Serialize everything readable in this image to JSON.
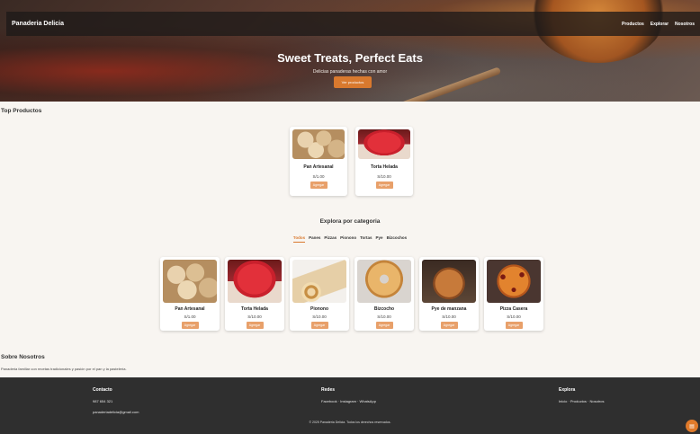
{
  "header": {
    "brand": "Panaderia Delicia",
    "nav": [
      "Productos",
      "Explorar",
      "Nosotros"
    ]
  },
  "hero": {
    "title": "Sweet Treats, Perfect Eats",
    "subtitle": "Delicias panaderas hechas con amor",
    "button": "Ver productos"
  },
  "top_products": {
    "title": "Top Productos",
    "items": [
      {
        "name": "Pan Artesanal",
        "price": "S/1.00",
        "button": "Agregar",
        "image_icon": "bread-image"
      },
      {
        "name": "Torta Helada",
        "price": "S/10.00",
        "button": "Agregar",
        "image_icon": "cake-image"
      }
    ]
  },
  "categories": {
    "title": "Explora por categoria",
    "filters": [
      "Todos",
      "Panes",
      "Pizzas",
      "Pionono",
      "Tortas",
      "Pye",
      "Bizcochos"
    ],
    "active_filter": "Todos",
    "items": [
      {
        "name": "Pan Artesanal",
        "price": "S/1.00",
        "button": "Agregar"
      },
      {
        "name": "Torta Helada",
        "price": "S/10.00",
        "button": "Agregar"
      },
      {
        "name": "Pionono",
        "price": "S/10.00",
        "button": "Agregar"
      },
      {
        "name": "Bizcocho",
        "price": "S/10.00",
        "button": "Agregar"
      },
      {
        "name": "Pye de manzana",
        "price": "S/10.00",
        "button": "Agregar"
      },
      {
        "name": "Pizza Casera",
        "price": "S/10.00",
        "button": "Agregar"
      }
    ]
  },
  "about": {
    "title": "Sobre Nosotros",
    "text": "Panaderia familiar con recetas tradicionales y pasión por el pan y la pastelería."
  },
  "footer": {
    "contact_title": "Contacto",
    "phone": "987 654 321",
    "email": "panaderiadelicia@gmail.com",
    "social_title": "Redes",
    "social_links": "Facebook · Instagram · WhatsApp",
    "explore_title": "Explora",
    "explore_links": "Inicio · Productos · Nosotros",
    "copyright": "© 2025 Panaderia Delicia. Todos los derechos reservados."
  },
  "colors": {
    "accent": "#d9792e",
    "footer_bg": "#2f2f2f",
    "page_bg": "#f8f5f1"
  }
}
